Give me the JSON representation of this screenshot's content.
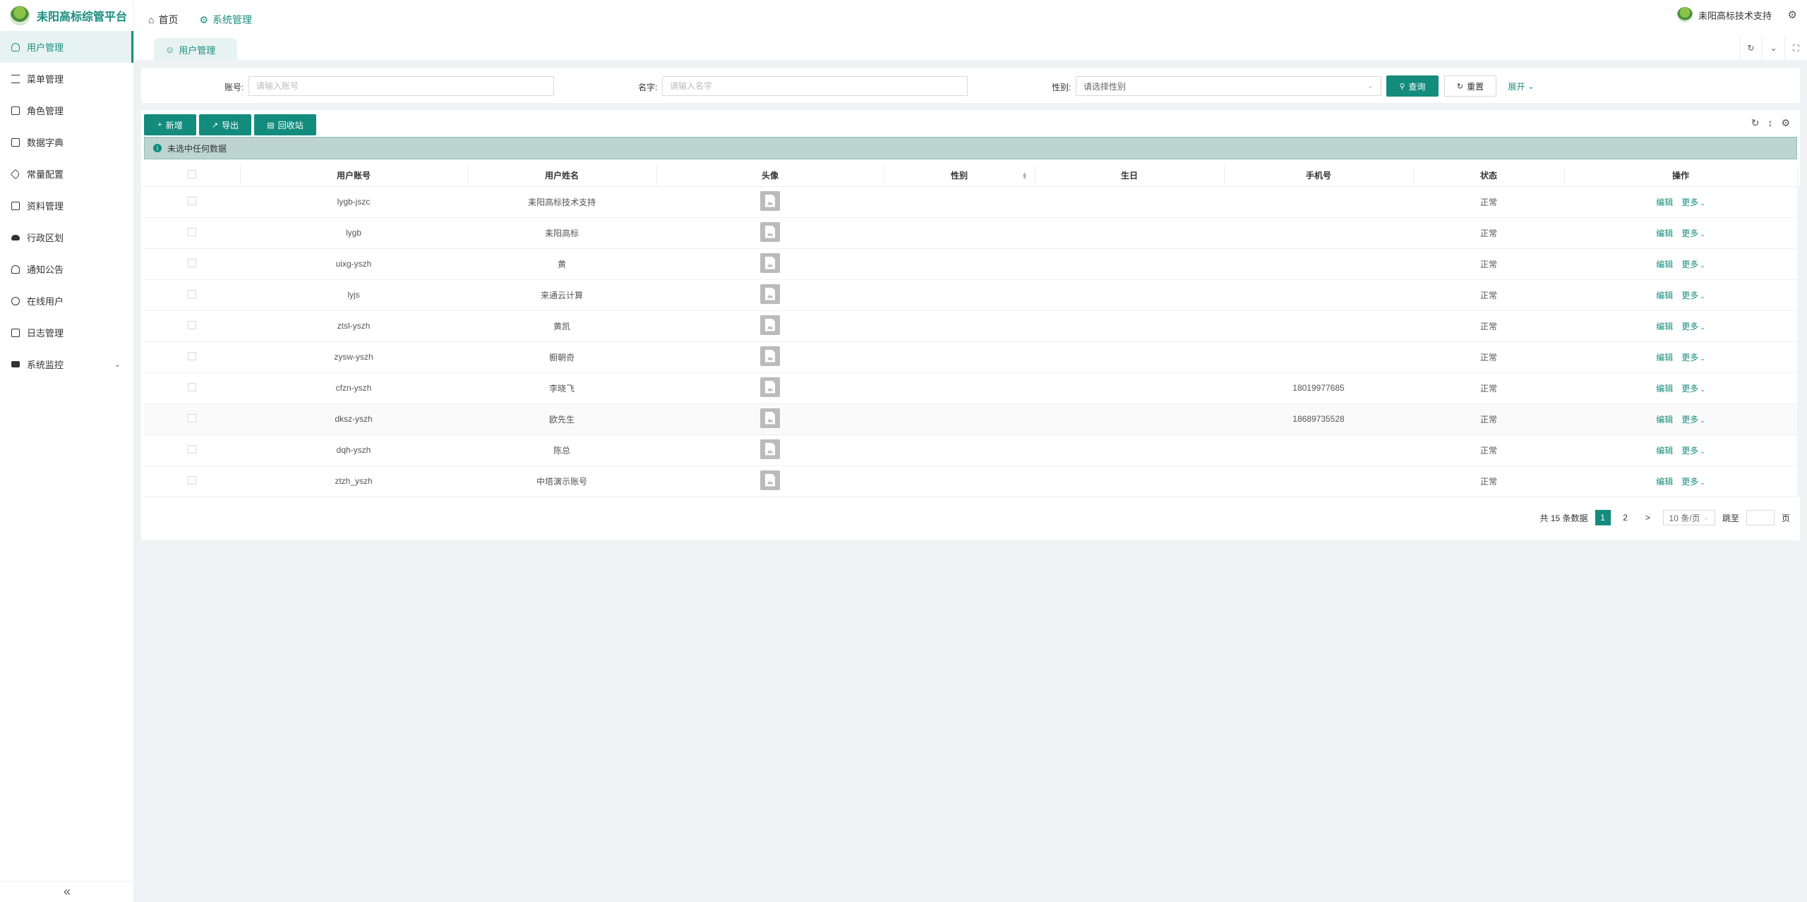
{
  "app": {
    "title": "耒阳高标综管平台"
  },
  "sidebar": {
    "items": [
      {
        "label": "用户管理",
        "icon": "user-icon"
      },
      {
        "label": "菜单管理",
        "icon": "list-icon"
      },
      {
        "label": "角色管理",
        "icon": "file-icon"
      },
      {
        "label": "数据字典",
        "icon": "book-icon"
      },
      {
        "label": "常量配置",
        "icon": "tag-icon"
      },
      {
        "label": "资料管理",
        "icon": "folder-icon"
      },
      {
        "label": "行政区划",
        "icon": "cloud-icon"
      },
      {
        "label": "通知公告",
        "icon": "bell-icon"
      },
      {
        "label": "在线用户",
        "icon": "online-icon"
      },
      {
        "label": "日志管理",
        "icon": "log-icon"
      },
      {
        "label": "系统监控",
        "icon": "monitor-icon"
      }
    ],
    "collapse_label": "«"
  },
  "header": {
    "nav": [
      {
        "label": "首页"
      },
      {
        "label": "系统管理"
      }
    ],
    "user_name": "耒阳高标技术支持"
  },
  "tabs": [
    {
      "label": "用户管理"
    }
  ],
  "search": {
    "account_label": "账号:",
    "account_placeholder": "请输入账号",
    "name_label": "名字:",
    "name_placeholder": "请输入名字",
    "gender_label": "性别:",
    "gender_placeholder": "请选择性别",
    "query_label": "查询",
    "reset_label": "重置",
    "expand_label": "展开"
  },
  "toolbar": {
    "add_label": "新增",
    "export_label": "导出",
    "recycle_label": "回收站"
  },
  "alert": {
    "text": "未选中任何数据"
  },
  "table": {
    "columns": [
      "用户账号",
      "用户姓名",
      "头像",
      "性别",
      "生日",
      "手机号",
      "状态",
      "操作"
    ],
    "rows": [
      {
        "account": "lygb-jszc",
        "name": "耒阳高标技术支持",
        "gender": "",
        "birthday": "",
        "phone": "",
        "status": "正常"
      },
      {
        "account": "lygb",
        "name": "耒阳高标",
        "gender": "",
        "birthday": "",
        "phone": "",
        "status": "正常"
      },
      {
        "account": "uixg-yszh",
        "name": "黄",
        "gender": "",
        "birthday": "",
        "phone": "",
        "status": "正常"
      },
      {
        "account": "lyjs",
        "name": "来通云计算",
        "gender": "",
        "birthday": "",
        "phone": "",
        "status": "正常"
      },
      {
        "account": "ztsl-yszh",
        "name": "黄凯",
        "gender": "",
        "birthday": "",
        "phone": "",
        "status": "正常"
      },
      {
        "account": "zysw-yszh",
        "name": "橱朝奇",
        "gender": "",
        "birthday": "",
        "phone": "",
        "status": "正常"
      },
      {
        "account": "cfzn-yszh",
        "name": "李晓飞",
        "gender": "",
        "birthday": "",
        "phone": "18019977685",
        "status": "正常"
      },
      {
        "account": "dksz-yszh",
        "name": "欧先生",
        "gender": "",
        "birthday": "",
        "phone": "18689735528",
        "status": "正常"
      },
      {
        "account": "dqh-yszh",
        "name": "陈总",
        "gender": "",
        "birthday": "",
        "phone": "",
        "status": "正常"
      },
      {
        "account": "ztzh_yszh",
        "name": "中塔演示账号",
        "gender": "",
        "birthday": "",
        "phone": "",
        "status": "正常"
      }
    ],
    "edit_label": "编辑",
    "more_label": "更多"
  },
  "pagination": {
    "total_text": "共 15 条数据",
    "pages": [
      "1",
      "2"
    ],
    "next_label": ">",
    "page_size": "10 条/页",
    "jump_label": "跳至",
    "page_suffix": "页"
  },
  "colors": {
    "accent": "#138b7d"
  }
}
